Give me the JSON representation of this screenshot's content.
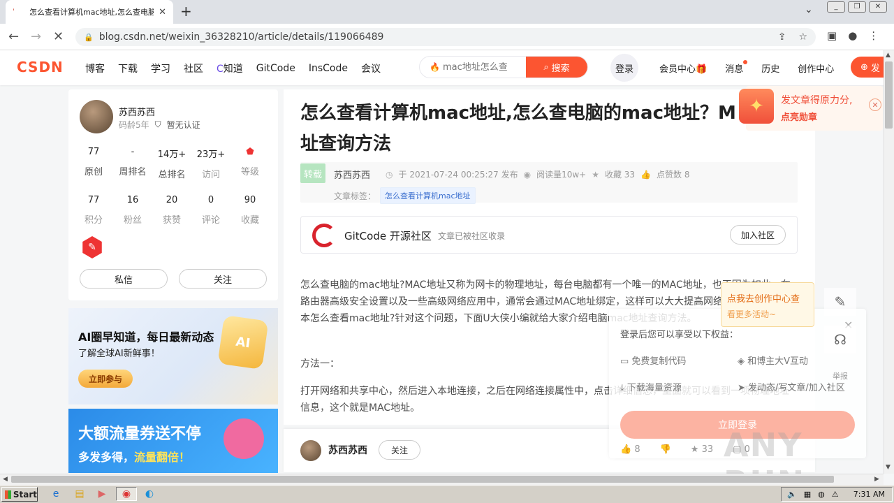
{
  "browser": {
    "tab_title": "怎么查看计算机mac地址,怎么查电脑",
    "url": "blog.csdn.net/weixin_36328210/article/details/119066489"
  },
  "header": {
    "logo": "CSDN",
    "nav": [
      "博客",
      "下载",
      "学习",
      "社区",
      "知道",
      "GitCode",
      "InsCode",
      "会议"
    ],
    "search_placeholder": "mac地址怎么查",
    "search_button": "搜索",
    "login": "登录",
    "links": [
      "会员中心",
      "消息",
      "历史",
      "创作中心"
    ],
    "publish": "发"
  },
  "profile": {
    "name": "苏西苏西",
    "code_age": "码龄5年",
    "cert": "暂无认证",
    "stats_row1": [
      {
        "n": "77",
        "l": "原创"
      },
      {
        "n": "-",
        "l": "周排名"
      },
      {
        "n": "14万+",
        "l": "总排名"
      },
      {
        "n": "23万+",
        "l": "访问"
      },
      {
        "n": "",
        "l": "等级"
      }
    ],
    "stats_row2": [
      {
        "n": "77",
        "l": "积分"
      },
      {
        "n": "16",
        "l": "粉丝"
      },
      {
        "n": "20",
        "l": "获赞"
      },
      {
        "n": "0",
        "l": "评论"
      },
      {
        "n": "90",
        "l": "收藏"
      }
    ],
    "message_btn": "私信",
    "follow_btn": "关注"
  },
  "ads": {
    "ad1_title": "AI圈早知道，每日最新动态",
    "ad1_sub": "了解全球AI新鲜事！",
    "ad1_btn": "立即参与",
    "ad2_title": "大额流量券送不停",
    "ad2_sub_a": "多发多得，",
    "ad2_sub_b": "流量翻倍！"
  },
  "article": {
    "title": "怎么查看计算机mac地址,怎么查电脑的mac地址？M ac地址查询方法",
    "tag_type": "转载",
    "author": "苏西苏西",
    "date": "于 2021-07-24 00:25:27 发布",
    "reads": "阅读量10w+",
    "favorites": "收藏 33",
    "likes": "点赞数 8",
    "tags_label": "文章标签：",
    "tag": "怎么查看计算机mac地址",
    "gitcode_title": "GitCode 开源社区",
    "gitcode_sub": "文章已被社区收录",
    "gitcode_join": "加入社区",
    "para1": "怎么查电脑的mac地址?MAC地址又称为网卡的物理地址，每台电脑都有一个唯一的MAC地址，也正因为如此，在路由器高级安全设置以及一些高级网络应用中，通常会通过MAC地址绑定，这样可以大大提高网络安全。究竟笔记本怎么查看mac地址?针对这个问题，下面U大侠小编就给大家介绍电脑mac地址查询方法。",
    "para2": "方法一：",
    "para3": "打开网络和共享中心，然后进入本地连接，之后在网络连接属性中，点击详细信息，里面就可以看到一项物理地址信息，这个就是MAC地址。",
    "footer_author": "苏西苏西",
    "footer_follow": "关注"
  },
  "promo": {
    "line1": "发文章得原力分,",
    "line2": "点亮勋章"
  },
  "tip": {
    "line1": "点我去创作中心查",
    "line2": "看更多活动~"
  },
  "login_panel": {
    "heading": "登录后您可以享受以下权益：",
    "benefit1": "免费复制代码",
    "benefit2": "和博主大V互动",
    "benefit3": "下载海量资源",
    "benefit4": "发动态/写文章/加入社区",
    "login_btn": "立即登录",
    "like_count": "8",
    "fav_count": "33",
    "comment_count": "0"
  },
  "sidetools": {
    "report": "举报"
  },
  "watermark": "ANY RUN",
  "taskbar": {
    "start": "Start",
    "time": "7:31 AM"
  }
}
